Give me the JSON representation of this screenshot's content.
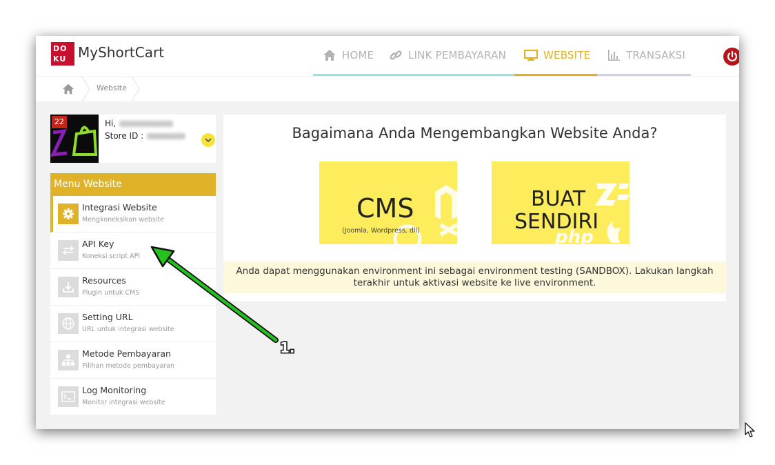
{
  "header": {
    "logo_text": "DOKU",
    "brand": "MyShortCart",
    "nav": [
      {
        "label": "HOME",
        "icon": "home-icon"
      },
      {
        "label": "LINK PEMBAYARAN",
        "icon": "link-icon"
      },
      {
        "label": "WEBSITE",
        "icon": "monitor-icon",
        "active": true
      },
      {
        "label": "TRANSAKSI",
        "icon": "bar-chart-icon"
      }
    ],
    "power_icon": "power-icon"
  },
  "breadcrumb": {
    "current": "Website"
  },
  "profile": {
    "badge": "22",
    "greeting": "Hi,",
    "store_label": "Store ID :"
  },
  "sidebar": {
    "title": "Menu Website",
    "items": [
      {
        "title": "Integrasi Website",
        "sub": "Mengkoneksikan website",
        "icon": "gear-icon",
        "active": true
      },
      {
        "title": "API Key",
        "sub": "Koneksi script API",
        "icon": "exchange-icon"
      },
      {
        "title": "Resources",
        "sub": "Plugin untuk CMS",
        "icon": "download-icon"
      },
      {
        "title": "Setting URL",
        "sub": "URL untuk integrasi website",
        "icon": "globe-icon"
      },
      {
        "title": "Metode Pembayaran",
        "sub": "Pilihan metode pembayaran",
        "icon": "sitemap-icon"
      },
      {
        "title": "Log Monitoring",
        "sub": "Monitor integrasi website",
        "icon": "terminal-icon"
      }
    ]
  },
  "main": {
    "question": "Bagaimana Anda Mengembangkan Website Anda?",
    "cms_title": "CMS",
    "cms_sub": "(Joomla, Wordpress, dll)",
    "buat_line1": "BUAT",
    "buat_line2": "SENDIRI",
    "notice": "Anda dapat menggunakan environment ini sebagai environment testing (SANDBOX). Lakukan langkah terakhir untuk aktivasi website ke live environment."
  },
  "annotation": {
    "label": "1."
  },
  "colors": {
    "accent": "#e0b22a",
    "card": "#fdec5c",
    "brand_red": "#c8102e",
    "arrow": "#25c21f"
  }
}
